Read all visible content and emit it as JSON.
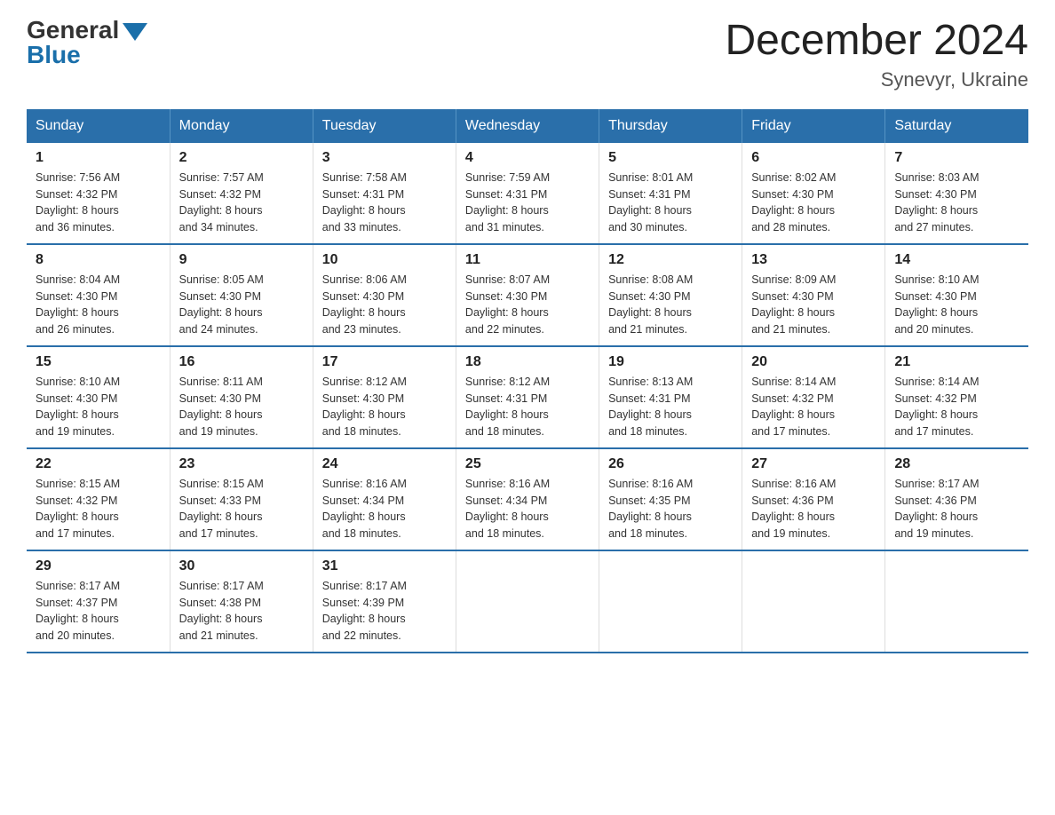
{
  "header": {
    "logo": {
      "general": "General",
      "blue": "Blue",
      "triangle": true
    },
    "title": "December 2024",
    "location": "Synevyr, Ukraine"
  },
  "calendar": {
    "days_of_week": [
      "Sunday",
      "Monday",
      "Tuesday",
      "Wednesday",
      "Thursday",
      "Friday",
      "Saturday"
    ],
    "weeks": [
      [
        {
          "day": "1",
          "sunrise": "7:56 AM",
          "sunset": "4:32 PM",
          "daylight": "8 hours and 36 minutes."
        },
        {
          "day": "2",
          "sunrise": "7:57 AM",
          "sunset": "4:32 PM",
          "daylight": "8 hours and 34 minutes."
        },
        {
          "day": "3",
          "sunrise": "7:58 AM",
          "sunset": "4:31 PM",
          "daylight": "8 hours and 33 minutes."
        },
        {
          "day": "4",
          "sunrise": "7:59 AM",
          "sunset": "4:31 PM",
          "daylight": "8 hours and 31 minutes."
        },
        {
          "day": "5",
          "sunrise": "8:01 AM",
          "sunset": "4:31 PM",
          "daylight": "8 hours and 30 minutes."
        },
        {
          "day": "6",
          "sunrise": "8:02 AM",
          "sunset": "4:30 PM",
          "daylight": "8 hours and 28 minutes."
        },
        {
          "day": "7",
          "sunrise": "8:03 AM",
          "sunset": "4:30 PM",
          "daylight": "8 hours and 27 minutes."
        }
      ],
      [
        {
          "day": "8",
          "sunrise": "8:04 AM",
          "sunset": "4:30 PM",
          "daylight": "8 hours and 26 minutes."
        },
        {
          "day": "9",
          "sunrise": "8:05 AM",
          "sunset": "4:30 PM",
          "daylight": "8 hours and 24 minutes."
        },
        {
          "day": "10",
          "sunrise": "8:06 AM",
          "sunset": "4:30 PM",
          "daylight": "8 hours and 23 minutes."
        },
        {
          "day": "11",
          "sunrise": "8:07 AM",
          "sunset": "4:30 PM",
          "daylight": "8 hours and 22 minutes."
        },
        {
          "day": "12",
          "sunrise": "8:08 AM",
          "sunset": "4:30 PM",
          "daylight": "8 hours and 21 minutes."
        },
        {
          "day": "13",
          "sunrise": "8:09 AM",
          "sunset": "4:30 PM",
          "daylight": "8 hours and 21 minutes."
        },
        {
          "day": "14",
          "sunrise": "8:10 AM",
          "sunset": "4:30 PM",
          "daylight": "8 hours and 20 minutes."
        }
      ],
      [
        {
          "day": "15",
          "sunrise": "8:10 AM",
          "sunset": "4:30 PM",
          "daylight": "8 hours and 19 minutes."
        },
        {
          "day": "16",
          "sunrise": "8:11 AM",
          "sunset": "4:30 PM",
          "daylight": "8 hours and 19 minutes."
        },
        {
          "day": "17",
          "sunrise": "8:12 AM",
          "sunset": "4:30 PM",
          "daylight": "8 hours and 18 minutes."
        },
        {
          "day": "18",
          "sunrise": "8:12 AM",
          "sunset": "4:31 PM",
          "daylight": "8 hours and 18 minutes."
        },
        {
          "day": "19",
          "sunrise": "8:13 AM",
          "sunset": "4:31 PM",
          "daylight": "8 hours and 18 minutes."
        },
        {
          "day": "20",
          "sunrise": "8:14 AM",
          "sunset": "4:32 PM",
          "daylight": "8 hours and 17 minutes."
        },
        {
          "day": "21",
          "sunrise": "8:14 AM",
          "sunset": "4:32 PM",
          "daylight": "8 hours and 17 minutes."
        }
      ],
      [
        {
          "day": "22",
          "sunrise": "8:15 AM",
          "sunset": "4:32 PM",
          "daylight": "8 hours and 17 minutes."
        },
        {
          "day": "23",
          "sunrise": "8:15 AM",
          "sunset": "4:33 PM",
          "daylight": "8 hours and 17 minutes."
        },
        {
          "day": "24",
          "sunrise": "8:16 AM",
          "sunset": "4:34 PM",
          "daylight": "8 hours and 18 minutes."
        },
        {
          "day": "25",
          "sunrise": "8:16 AM",
          "sunset": "4:34 PM",
          "daylight": "8 hours and 18 minutes."
        },
        {
          "day": "26",
          "sunrise": "8:16 AM",
          "sunset": "4:35 PM",
          "daylight": "8 hours and 18 minutes."
        },
        {
          "day": "27",
          "sunrise": "8:16 AM",
          "sunset": "4:36 PM",
          "daylight": "8 hours and 19 minutes."
        },
        {
          "day": "28",
          "sunrise": "8:17 AM",
          "sunset": "4:36 PM",
          "daylight": "8 hours and 19 minutes."
        }
      ],
      [
        {
          "day": "29",
          "sunrise": "8:17 AM",
          "sunset": "4:37 PM",
          "daylight": "8 hours and 20 minutes."
        },
        {
          "day": "30",
          "sunrise": "8:17 AM",
          "sunset": "4:38 PM",
          "daylight": "8 hours and 21 minutes."
        },
        {
          "day": "31",
          "sunrise": "8:17 AM",
          "sunset": "4:39 PM",
          "daylight": "8 hours and 22 minutes."
        },
        null,
        null,
        null,
        null
      ]
    ],
    "labels": {
      "sunrise": "Sunrise:",
      "sunset": "Sunset:",
      "daylight": "Daylight:"
    }
  }
}
